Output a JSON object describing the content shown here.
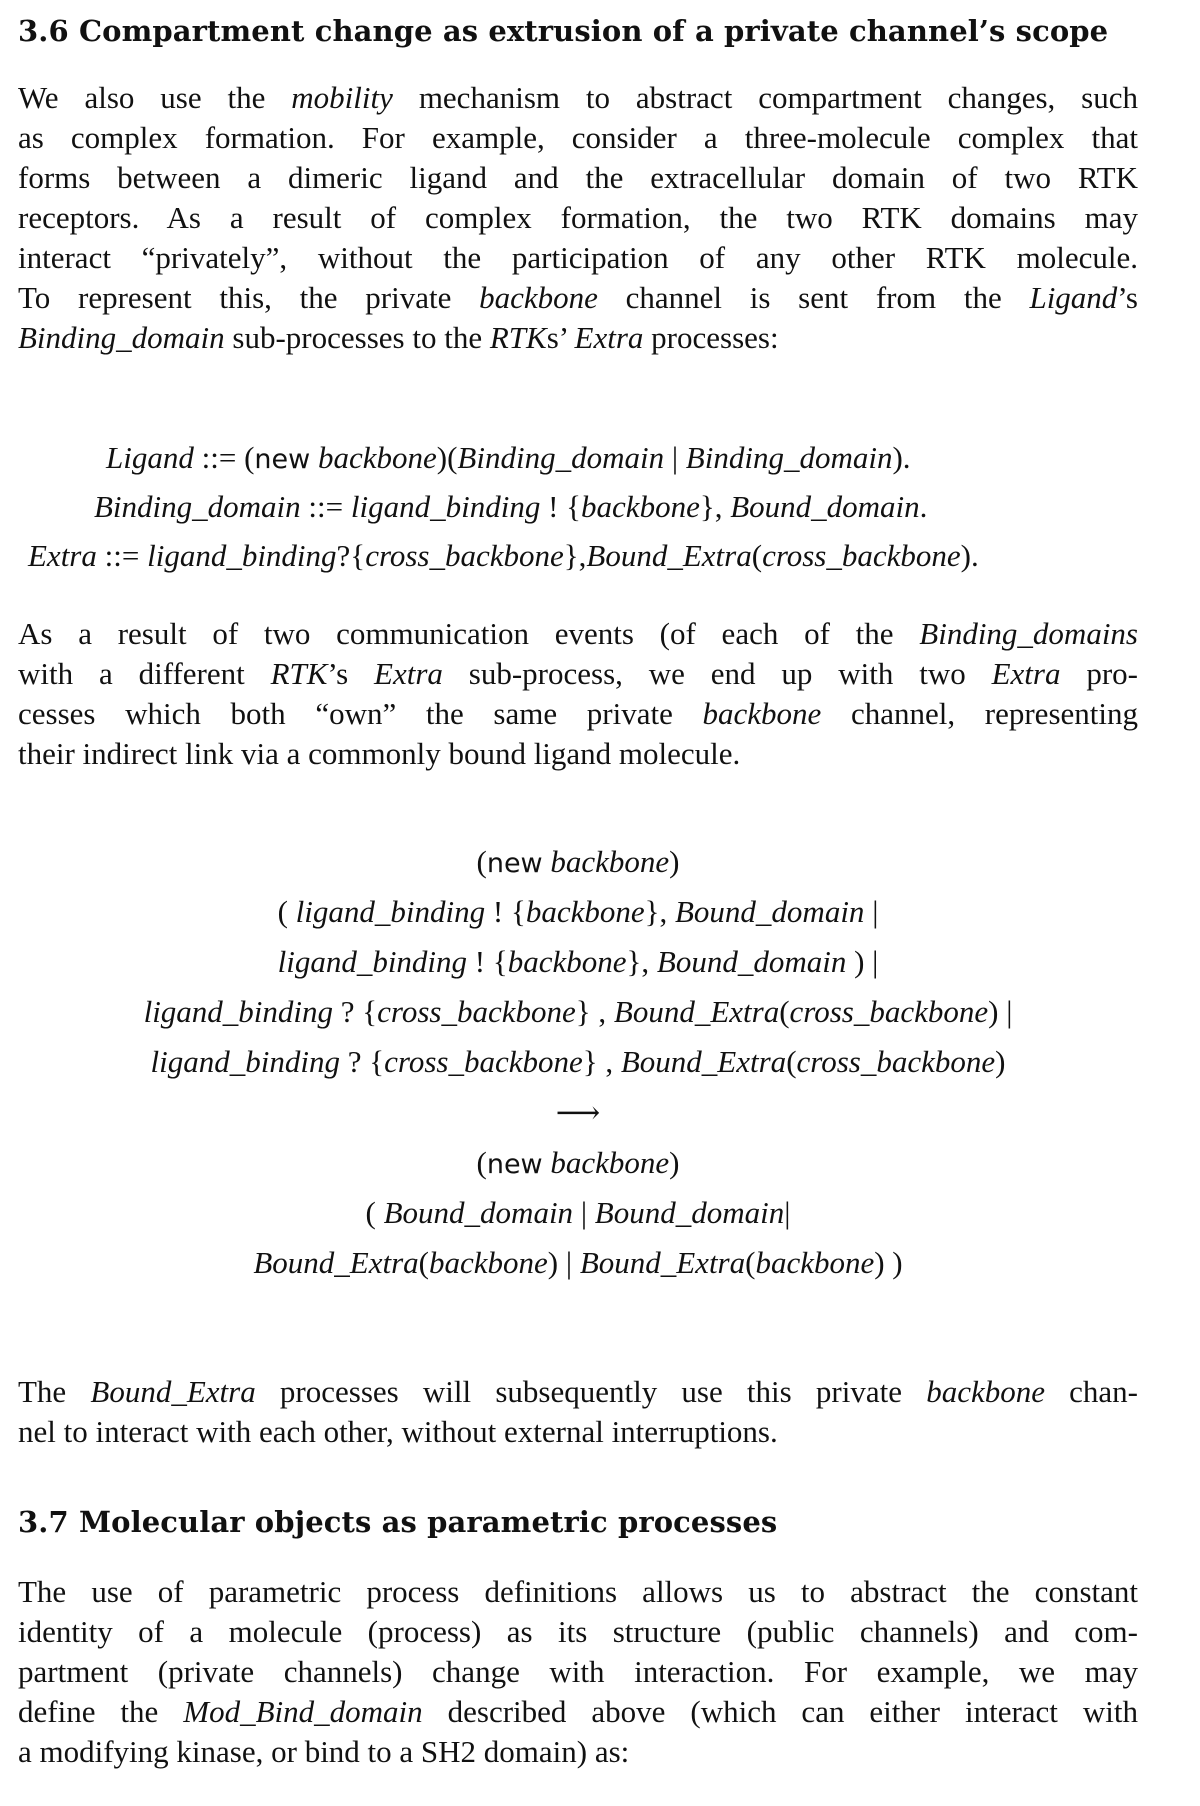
{
  "section_36": {
    "heading": "3.6 Compartment change as extrusion of a private channel’s scope",
    "para1": {
      "l1a": "We also use the ",
      "l1i": "mobility",
      "l1b": " mechanism to abstract compartment changes, such",
      "l2": "as complex formation. For example, consider a three-molecule complex that",
      "l3": "forms between a dimeric ligand and the extracellular domain of two RTK",
      "l4": "receptors. As a result of complex formation, the two RTK domains may",
      "l5": "interact “privately”, without the participation of any other RTK molecule.",
      "l6a": "To represent this, the private ",
      "l6i": "backbone",
      "l6b": " channel is sent from the ",
      "l6i2": "Ligand",
      "l6c": "’s",
      "l7i": "Binding_domain",
      "l7a": " sub-processes to the ",
      "l7i2": "RTK",
      "l7b": "s’ ",
      "l7i3": "Extra",
      "l7c": " processes:"
    },
    "rules": {
      "r1_lhs": "Ligand",
      "r1_op": " ::= ",
      "r1_new": "new",
      "r1_rest_i": " backbone",
      "r1_rest": ")(",
      "r1_a": "Binding_domain",
      "r1_bar": " | ",
      "r1_b": "Binding_domain",
      "r1_end": ").",
      "r2_lhs": "Binding_domain",
      "r2_op": " ::= ",
      "r2_a": "ligand_binding",
      "r2_mid": " ! {",
      "r2_b": "backbone",
      "r2_mid2": "}, ",
      "r2_c": "Bound_domain",
      "r2_end": ".",
      "r3_lhs": "Extra",
      "r3_op": " ::= ",
      "r3_a": "ligand_binding",
      "r3_mid": "?{",
      "r3_b": "cross_backbone",
      "r3_mid2": "},",
      "r3_c": "Bound_Extra",
      "r3_p": "(",
      "r3_d": "cross_backbone",
      "r3_end": ")."
    },
    "para2": {
      "l1a": "As a result of two communication events (of each of the ",
      "l1i": "Binding_domains",
      "l2a": "with a different ",
      "l2i": "RTK",
      "l2b": "’s ",
      "l2i2": "Extra",
      "l2c": " sub-process, we end up with two ",
      "l2i3": "Extra",
      "l2d": " pro-",
      "l3a": "cesses which both “own” the same private ",
      "l3i": "backbone",
      "l3b": " channel, representing",
      "l4": "their indirect link via a commonly bound ligand molecule."
    },
    "reduction": {
      "new_kw": "new",
      "backbone": "backbone",
      "line2a": "( ",
      "line2b": "ligand_binding",
      "line2c": " ! {",
      "line2d": "backbone",
      "line2e": "}, ",
      "line2f": "Bound_domain",
      "line2g": " |",
      "line3b": "ligand_binding",
      "line3c": " ! {",
      "line3d": "backbone",
      "line3e": "}, ",
      "line3f": "Bound_domain",
      "line3g": " ) |",
      "line4b": "ligand_binding",
      "line4c": " ? {",
      "line4d": "cross_backbone",
      "line4e": "} , ",
      "line4f": "Bound_Extra",
      "line4g": "(",
      "line4h": "cross_backbone",
      "line4i": ") |",
      "line5b": "ligand_binding",
      "line5c": " ? {",
      "line5d": "cross_backbone",
      "line5e": "} , ",
      "line5f": "Bound_Extra",
      "line5g": "(",
      "line5h": "cross_backbone",
      "line5i": ")",
      "arrow": "⟶",
      "line8a": "( ",
      "line8b": "Bound_domain",
      "line8c": " | ",
      "line8d": "Bound_domain",
      "line8e": "|",
      "line9a": "Bound_Extra",
      "line9b": "(",
      "line9c": "backbone",
      "line9d": ") | ",
      "line9e": "Bound_Extra",
      "line9f": "(",
      "line9g": "backbone",
      "line9h": ")  )"
    },
    "para3": {
      "l1a": "The ",
      "l1i": "Bound_Extra",
      "l1b": " processes will subsequently use this private ",
      "l1i2": "backbone",
      "l1c": " chan-",
      "l2": "nel to interact with each other, without external interruptions."
    }
  },
  "section_37": {
    "heading": "3.7 Molecular objects as parametric processes",
    "para1": {
      "l1": "The use of parametric process definitions allows us to abstract the constant",
      "l2": "identity of a molecule (process) as its structure (public channels) and com-",
      "l3": "partment (private channels) change with interaction. For example, we may",
      "l4a": "define the ",
      "l4i": "Mod_Bind_domain",
      "l4b": " described above (which can either interact with",
      "l5": "a modifying kinase, or bind to a SH2 domain) as:"
    }
  }
}
